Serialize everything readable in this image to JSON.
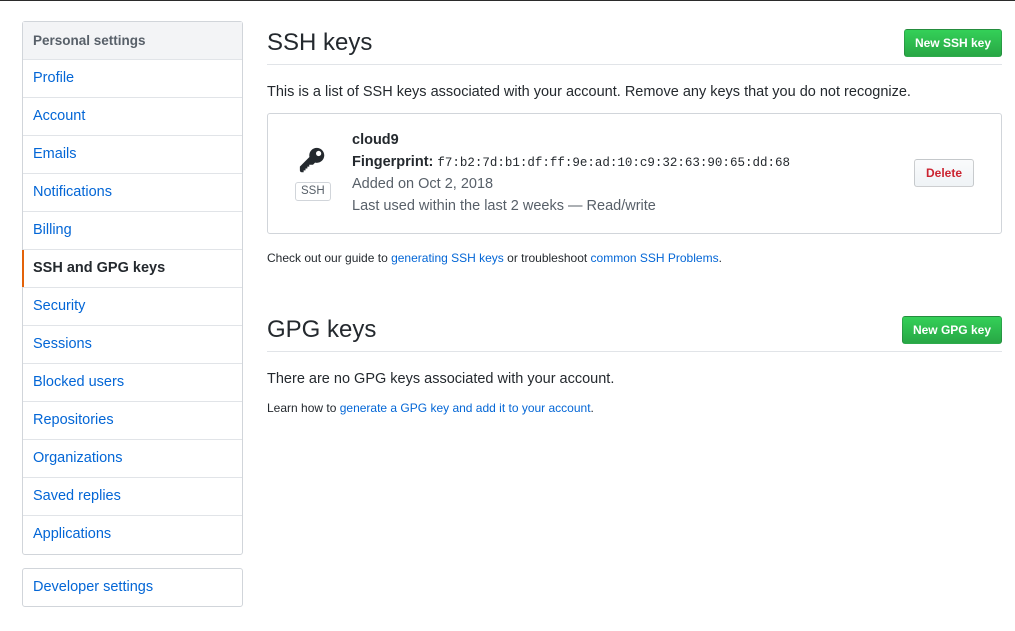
{
  "sidebar": {
    "heading": "Personal settings",
    "items": [
      {
        "label": "Profile"
      },
      {
        "label": "Account"
      },
      {
        "label": "Emails"
      },
      {
        "label": "Notifications"
      },
      {
        "label": "Billing"
      },
      {
        "label": "SSH and GPG keys",
        "selected": true
      },
      {
        "label": "Security"
      },
      {
        "label": "Sessions"
      },
      {
        "label": "Blocked users"
      },
      {
        "label": "Repositories"
      },
      {
        "label": "Organizations"
      },
      {
        "label": "Saved replies"
      },
      {
        "label": "Applications"
      }
    ],
    "developer_settings": "Developer settings"
  },
  "ssh": {
    "title": "SSH keys",
    "new_button": "New SSH key",
    "description": "This is a list of SSH keys associated with your account. Remove any keys that you do not recognize.",
    "key": {
      "icon": "key-icon",
      "badge": "SSH",
      "title": "cloud9",
      "fingerprint_label": "Fingerprint:",
      "fingerprint": "f7:b2:7d:b1:df:ff:9e:ad:10:c9:32:63:90:65:dd:68",
      "added": "Added on Oct 2, 2018",
      "last_used": "Last used within the last 2 weeks — Read/write",
      "delete_label": "Delete"
    },
    "note": {
      "prefix": "Check out our guide to ",
      "link1": "generating SSH keys",
      "middle": " or troubleshoot ",
      "link2": "common SSH Problems",
      "suffix": "."
    }
  },
  "gpg": {
    "title": "GPG keys",
    "new_button": "New GPG key",
    "description": "There are no GPG keys associated with your account.",
    "note": {
      "prefix": "Learn how to ",
      "link": "generate a GPG key and add it to your account",
      "suffix": "."
    }
  },
  "colors": {
    "link": "#0366d6",
    "green_button": "#28a745",
    "danger": "#cb2431",
    "selected_accent": "#e36209"
  }
}
